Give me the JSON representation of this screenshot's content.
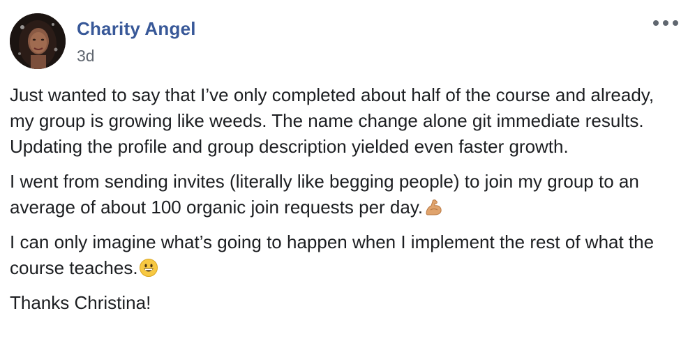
{
  "post": {
    "author": "Charity Angel",
    "timestamp": "3d",
    "more_icon": "ellipsis-icon",
    "paragraphs": [
      {
        "text": "Just wanted to say that I’ve only completed about half of the course and already, my group is growing like weeds. The name change alone git immediate results. Updating the profile and group description yielded even faster growth.",
        "emoji": ""
      },
      {
        "text": "I went from sending invites (literally like begging people) to join my group to an average of about 100 organic join requests per day.",
        "emoji": "flexed-biceps-emoji"
      },
      {
        "text": "I can only imagine what’s going to happen when I implement the rest of what the course teaches.",
        "emoji": "grinning-face-emoji"
      },
      {
        "text": "Thanks Christina!",
        "emoji": ""
      }
    ]
  },
  "colors": {
    "author_link": "#385898",
    "timestamp": "#616770",
    "body_text": "#1c1e21",
    "more_dots": "#606770"
  }
}
